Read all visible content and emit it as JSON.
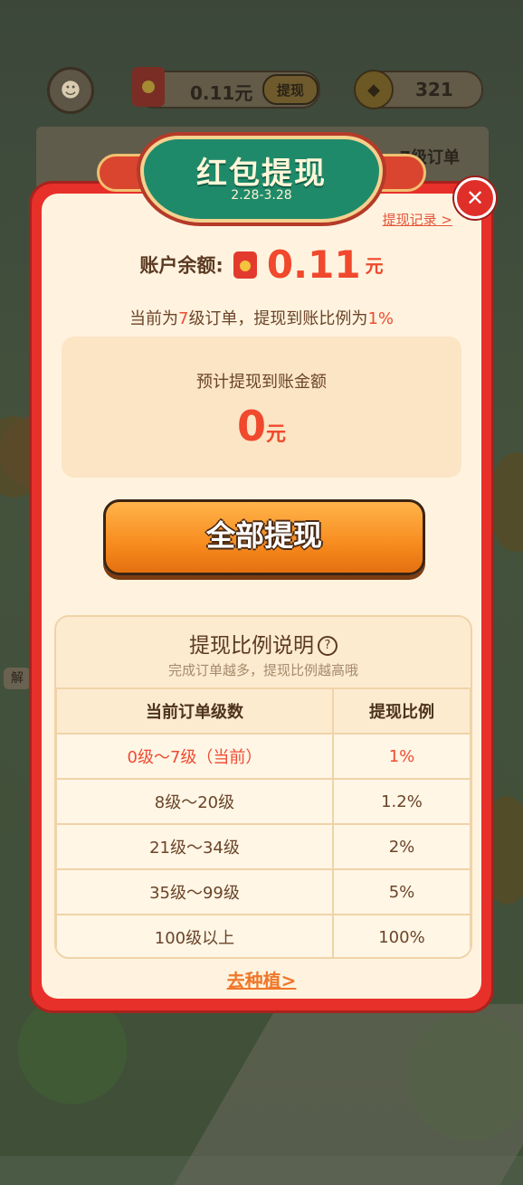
{
  "topbar": {
    "money_value": "0.11元",
    "withdraw_chip": "提现",
    "coin_value": "321"
  },
  "background": {
    "board_text": "7级订单",
    "side_text": "解"
  },
  "dialog": {
    "title": "红包提现",
    "date_range": "2.28-3.28",
    "record_link": "提现记录 >",
    "balance_label": "账户余额:",
    "balance_value": "0.11",
    "balance_unit": "元",
    "order_line": {
      "prefix": "当前为",
      "level": "7",
      "middle": "级订单，提现到账比例为",
      "ratio": "1%"
    },
    "estimate": {
      "label": "预计提现到账金额",
      "value": "0",
      "unit": "元"
    },
    "withdraw_all_label": "全部提现",
    "ratio_panel": {
      "title": "提现比例说明",
      "help_symbol": "?",
      "subtitle": "完成订单越多，提现比例越高哦",
      "headers": [
        "当前订单级数",
        "提现比例"
      ],
      "rows": [
        {
          "level": "0级～7级（当前）",
          "ratio": "1%"
        },
        {
          "level": "8级～20级",
          "ratio": "1.2%"
        },
        {
          "level": "21级～34级",
          "ratio": "2%"
        },
        {
          "level": "35级～99级",
          "ratio": "5%"
        },
        {
          "level": "100级以上",
          "ratio": "100%"
        }
      ]
    },
    "plant_link": "去种植>"
  },
  "colors": {
    "dialog_red": "#e8302a",
    "accent_orange": "#f0492d",
    "banner_green": "#1f8a6a",
    "button_orange": "#f78b1f"
  }
}
